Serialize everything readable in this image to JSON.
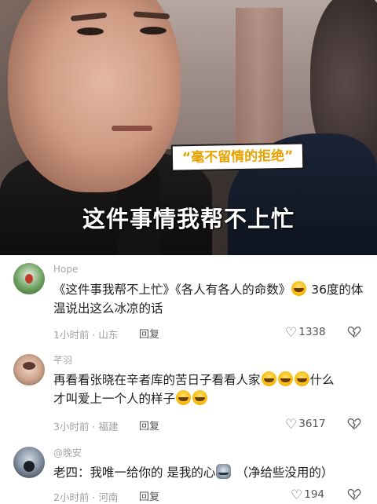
{
  "video": {
    "tag_text": "“毫不留情的拒绝”",
    "subtitle": "这件事情我帮不上忙"
  },
  "comments": [
    {
      "username": "Hope",
      "text_before": "《这件事我帮不上忙》《各人有各人的命数》",
      "emoji": "laugh-cry",
      "text_after": "36度的体温说出这么冰凉的话",
      "time_location": "1小时前 · 山东",
      "reply_label": "回复",
      "likes": "1338"
    },
    {
      "username": "芊羽",
      "text_before": "再看看张晓在辛者库的苦日子看看人家",
      "emoji": "laugh-cry",
      "text_after_line1": "什么",
      "text_line2": "才叫爱上一个人的样子",
      "time_location": "3小时前 · 福建",
      "reply_label": "回复",
      "likes": "3617"
    },
    {
      "username": "@晚安",
      "text_before": "老四：我唯一给你的 是我的心",
      "emoji": "cat",
      "text_after": "（净给些没用的）",
      "time_location": "2小时前 · 河南",
      "reply_label": "回复",
      "likes": "194"
    }
  ],
  "icons": {
    "like": "heart-outline-icon",
    "dislike": "broken-heart-icon"
  }
}
